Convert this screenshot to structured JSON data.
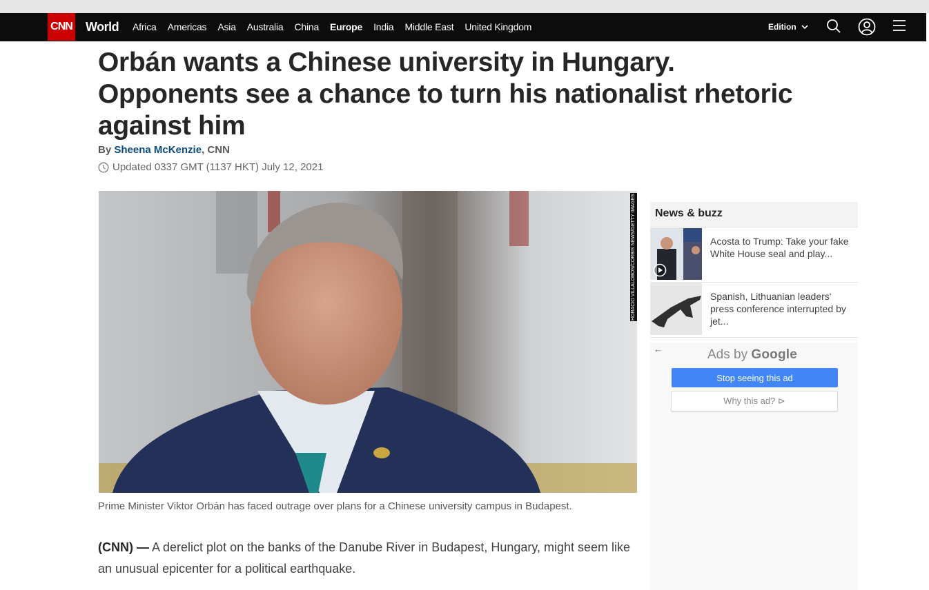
{
  "nav": {
    "logo": "CNN",
    "section": "World",
    "links": [
      "Africa",
      "Americas",
      "Asia",
      "Australia",
      "China",
      "Europe",
      "India",
      "Middle East",
      "United Kingdom"
    ],
    "active_link": "Europe",
    "edition_label": "Edition"
  },
  "article": {
    "headline_lines": [
      "Orbán wants a Chinese university in Hungary.",
      "Opponents see a chance to turn his nationalist rhetoric",
      "against him"
    ],
    "byline_prefix": "By ",
    "author": "Sheena McKenzie",
    "byline_suffix": ", CNN",
    "updated": "Updated 0337 GMT (1137 HKT) July 12, 2021",
    "photo_credit": "HORACIO VILLALOBOS/CORBIS NEWS/GETTY IMAGES",
    "caption": "Prime Minister Viktor Orbán has faced outrage over plans for a Chinese university campus in Budapest.",
    "lead_prefix": "(CNN) —",
    "lead_text": " A derelict plot on the banks of the Danube River in Budapest, Hungary, might seem like an unusual epicenter for a political earthquake."
  },
  "sidebar": {
    "title": "News & buzz",
    "items": [
      {
        "text": "Acosta to Trump: Take your fake White House seal and play...",
        "has_video": true
      },
      {
        "text": "Spanish, Lithuanian leaders' press conference interrupted by jet...",
        "has_video": false
      }
    ]
  },
  "ad": {
    "back_arrow": "←",
    "ads_by": "Ads by ",
    "google": "Google",
    "stop_label": "Stop seeing this ad",
    "why_label": "Why this ad? ⊳"
  },
  "colors": {
    "nav_bg": "#0c0c0c",
    "brand_red": "#cc0000",
    "author_link": "#0c4a7c",
    "ad_button": "#4285f4"
  }
}
